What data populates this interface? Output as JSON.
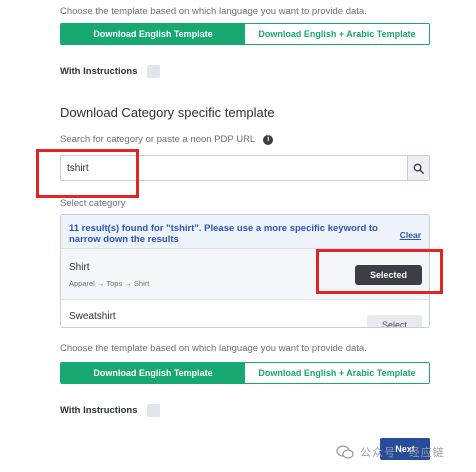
{
  "top_section": {
    "hint": "Choose the template based on which language you want to provide data.",
    "download_english": "Download English Template",
    "download_english_arabic": "Download English + Arabic Template",
    "with_instructions": "With Instructions"
  },
  "category_section": {
    "title": "Download Category specific template",
    "search_label": "Search for category or paste a noon PDP URL",
    "info_icon_glyph": "i",
    "search_value": "tshirt",
    "select_label": "Select category",
    "results_message": "11 result(s) found for \"tshirt\". Please use a more specific keyword to narrow down the results",
    "clear_label": "Clear",
    "results": [
      {
        "name": "Shirt",
        "path": "Apparel → Tops → Shirt",
        "action": "Selected"
      },
      {
        "name": "Sweatshirt",
        "action": "Select"
      }
    ]
  },
  "bottom_section": {
    "hint": "Choose the template based on which language you want to provide data.",
    "download_english": "Download English Template",
    "download_english_arabic": "Download English + Arabic Template",
    "with_instructions": "With Instructions"
  },
  "footer": {
    "next_label": "Next",
    "watermark_text": "公众号 · 经应链"
  },
  "colors": {
    "accent_green": "#18a872",
    "primary_blue": "#274c9b",
    "highlight_red": "#e32424",
    "link_blue": "#2a56b8"
  },
  "icons": [
    "info-icon",
    "search-icon",
    "wechat-icon"
  ]
}
